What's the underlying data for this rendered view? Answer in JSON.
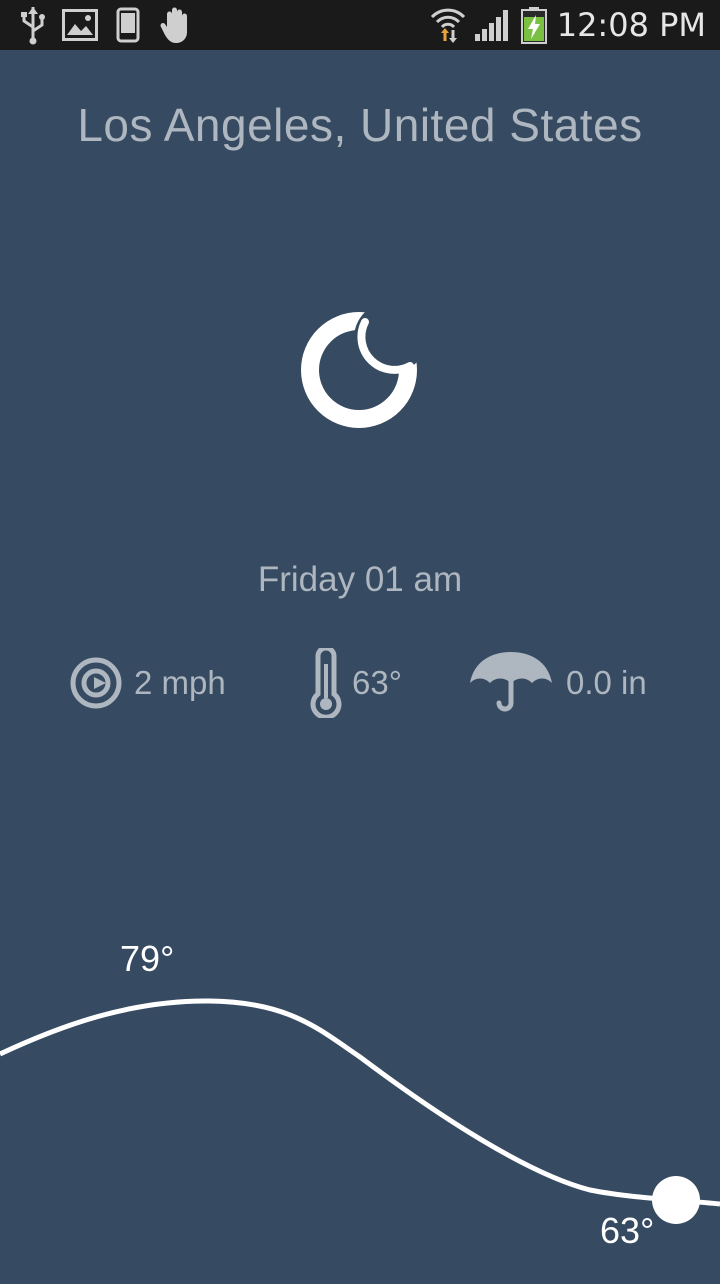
{
  "status_bar": {
    "time": "12:08 PM",
    "icons": [
      "usb-icon",
      "image-icon",
      "phone-icon",
      "hand-icon",
      "wifi-icon",
      "signal-icon",
      "battery-charging-icon"
    ]
  },
  "location": "Los Angeles, United States",
  "condition_icon": "moon-icon",
  "datetime": "Friday 01 am",
  "metrics": {
    "wind": "2 mph",
    "temperature": "63°",
    "precipitation": "0.0 in"
  },
  "graph": {
    "high_label": "79°",
    "current_label": "63°"
  },
  "colors": {
    "background": "#364A61",
    "text_muted": "#AEB6C0",
    "accent": "#FFFFFF",
    "status_bar": "#1A1A1A"
  }
}
